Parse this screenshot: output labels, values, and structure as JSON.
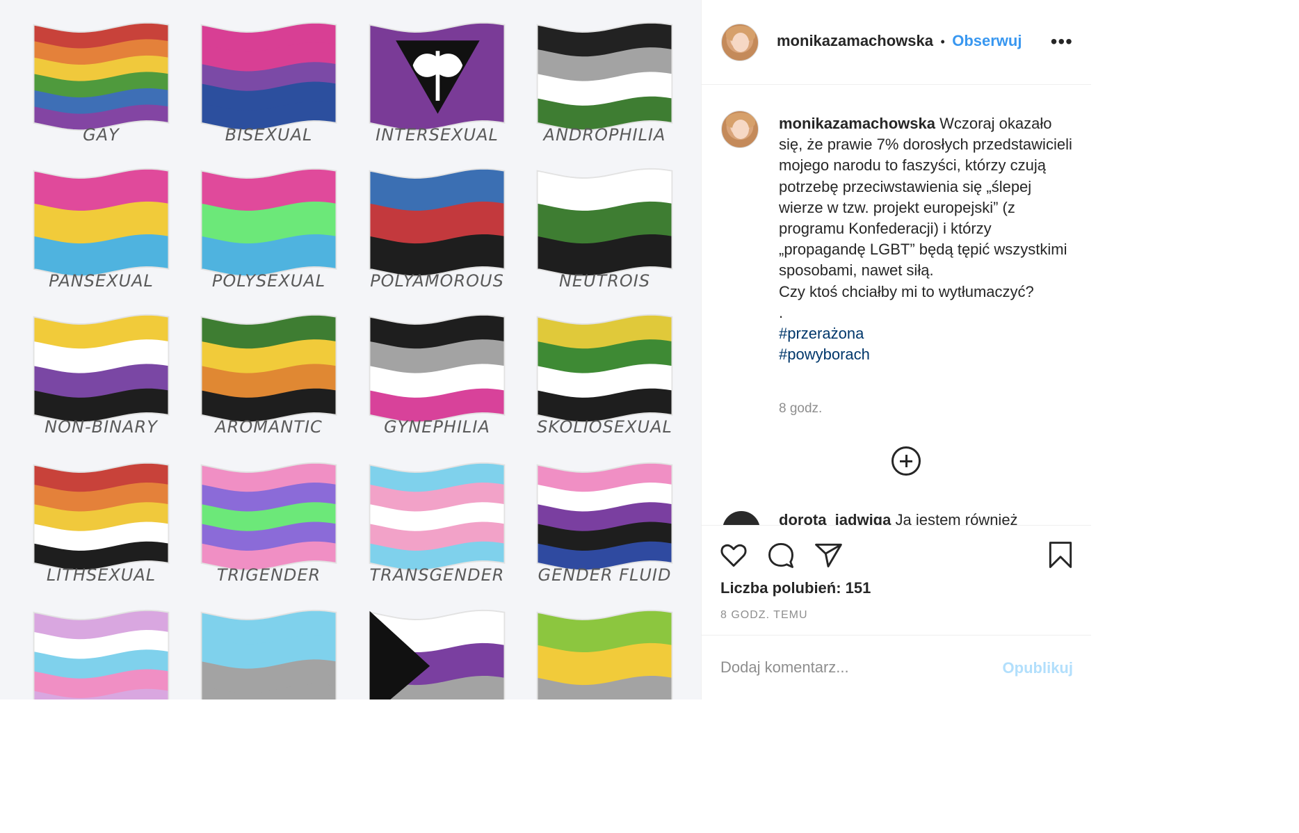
{
  "post": {
    "username": "monikazamachowska",
    "follow_label": "Obserwuj",
    "separator": "•",
    "more_label": "•••"
  },
  "flags": [
    {
      "label": "GAY",
      "stripes": [
        "#c8423a",
        "#e4813a",
        "#f0c93c",
        "#4f9a3d",
        "#3e6fb6",
        "#8345a3"
      ]
    },
    {
      "label": "BISEXUAL",
      "stripes": [
        "#d83f94",
        "#d83f94",
        "#7b4aa6",
        "#2c4f9e",
        "#2c4f9e"
      ]
    },
    {
      "label": "INTERSEXUAL",
      "stripes": [
        "#7a3b97"
      ],
      "emblem": "labrys"
    },
    {
      "label": "ANDROPHILIA",
      "stripes": [
        "#222222",
        "#a3a3a3",
        "#ffffff",
        "#3e7d32"
      ]
    },
    {
      "label": "PANSEXUAL",
      "stripes": [
        "#e04a9b",
        "#f1cb3a",
        "#4fb3df"
      ]
    },
    {
      "label": "POLYSEXUAL",
      "stripes": [
        "#e04a9b",
        "#6ce879",
        "#4fb3df"
      ]
    },
    {
      "label": "POLYAMOROUS",
      "stripes": [
        "#3b6fb3",
        "#c3393d",
        "#1e1e1e"
      ]
    },
    {
      "label": "NEUTROIS",
      "stripes": [
        "#ffffff",
        "#3e7d32",
        "#1e1e1e"
      ]
    },
    {
      "label": "NON-BINARY",
      "stripes": [
        "#f1cb3a",
        "#ffffff",
        "#7a47a4",
        "#1e1e1e"
      ]
    },
    {
      "label": "AROMANTIC",
      "stripes": [
        "#3e7d32",
        "#f1cb3a",
        "#e08833",
        "#1e1e1e"
      ]
    },
    {
      "label": "GYNEPHILIA",
      "stripes": [
        "#1e1e1e",
        "#a3a3a3",
        "#ffffff",
        "#d8429a"
      ]
    },
    {
      "label": "SKOLIOSEXUAL",
      "stripes": [
        "#e0c93a",
        "#3e8a34",
        "#ffffff",
        "#1e1e1e"
      ]
    },
    {
      "label": "LITHSEXUAL",
      "stripes": [
        "#c8423a",
        "#e4813a",
        "#f0c93c",
        "#ffffff",
        "#1e1e1e"
      ]
    },
    {
      "label": "TRIGENDER",
      "stripes": [
        "#f08fc4",
        "#8b6bd8",
        "#6ce879",
        "#8b6bd8",
        "#f08fc4"
      ]
    },
    {
      "label": "TRANSGENDER",
      "stripes": [
        "#7fd1ec",
        "#f2a2c8",
        "#ffffff",
        "#f2a2c8",
        "#7fd1ec"
      ]
    },
    {
      "label": "GENDER FLUID",
      "stripes": [
        "#f08fc4",
        "#ffffff",
        "#7a3fa0",
        "#1e1e1e",
        "#2f4aa0"
      ]
    },
    {
      "label": "",
      "stripes": [
        "#d9a7e0",
        "#ffffff",
        "#7fd1ec",
        "#f08fc4",
        "#d9a7e0"
      ]
    },
    {
      "label": "",
      "stripes": [
        "#7fd1ec",
        "#7fd1ec",
        "#a3a3a3",
        "#a3a3a3"
      ]
    },
    {
      "label": "",
      "stripes": [
        "#ffffff",
        "#7a3fa0",
        "#a3a3a3"
      ],
      "emblem": "chevron"
    },
    {
      "label": "",
      "stripes": [
        "#8cc63f",
        "#f1cb3a",
        "#a3a3a3"
      ]
    }
  ],
  "caption": {
    "text": " Wczoraj okazało się, że prawie 7% dorosłych przedstawicieli mojego narodu to faszyści, którzy czują potrzebę przeciwstawienia się „ślepej wierze w tzw. projekt europejski” (z programu Konfederacji) i którzy „propagandę LGBT” będą tępić wszystkimi sposobami, nawet siłą.\nCzy ktoś chciałby mi to wytłumaczyć?\n.",
    "hashtags": [
      "#przerażona",
      "#powyborach"
    ],
    "time": "8 godz."
  },
  "comment_peek": {
    "username": "dorota_jadwiga",
    "text": "Ja jestem również"
  },
  "actions": {
    "likes_text": "Liczba polubień: 151",
    "time_ago": "8 GODZ. TEMU"
  },
  "comment_form": {
    "placeholder": "Dodaj komentarz...",
    "publish_label": "Opublikuj"
  },
  "icons": [
    "heart-icon",
    "comment-icon",
    "share-icon",
    "bookmark-icon",
    "plus-circle-icon",
    "more-icon"
  ]
}
